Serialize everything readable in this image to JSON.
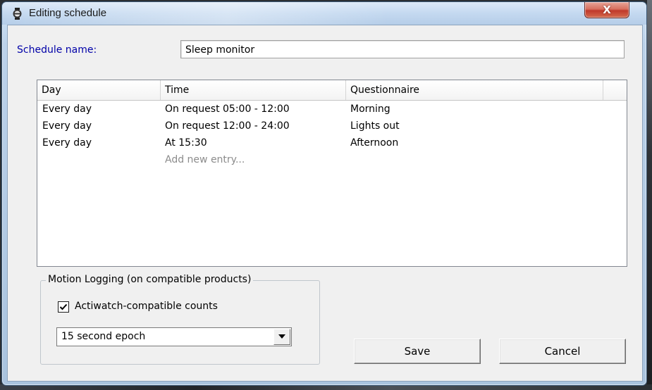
{
  "window": {
    "title": "Editing schedule",
    "close_glyph": "X",
    "title_icon": "watch-icon"
  },
  "schedule": {
    "label": "Schedule name:",
    "value": "Sleep monitor"
  },
  "table": {
    "columns": [
      "Day",
      "Time",
      "Questionnaire"
    ],
    "rows": [
      {
        "day": "Every day",
        "time": "On request 05:00 - 12:00",
        "questionnaire": "Morning"
      },
      {
        "day": "Every day",
        "time": "On request 12:00 - 24:00",
        "questionnaire": "Lights out"
      },
      {
        "day": "Every day",
        "time": "At 15:30",
        "questionnaire": "Afternoon"
      }
    ],
    "add_entry_label": "Add new entry..."
  },
  "motion_logging": {
    "group_title": "Motion Logging (on compatible products)",
    "checkbox_label": "Actiwatch-compatible counts",
    "checkbox_checked": true,
    "epoch_selected": "15 second epoch"
  },
  "buttons": {
    "save": "Save",
    "cancel": "Cancel"
  },
  "colors": {
    "label_blue": "#0000a8",
    "close_red": "#c0392b"
  }
}
